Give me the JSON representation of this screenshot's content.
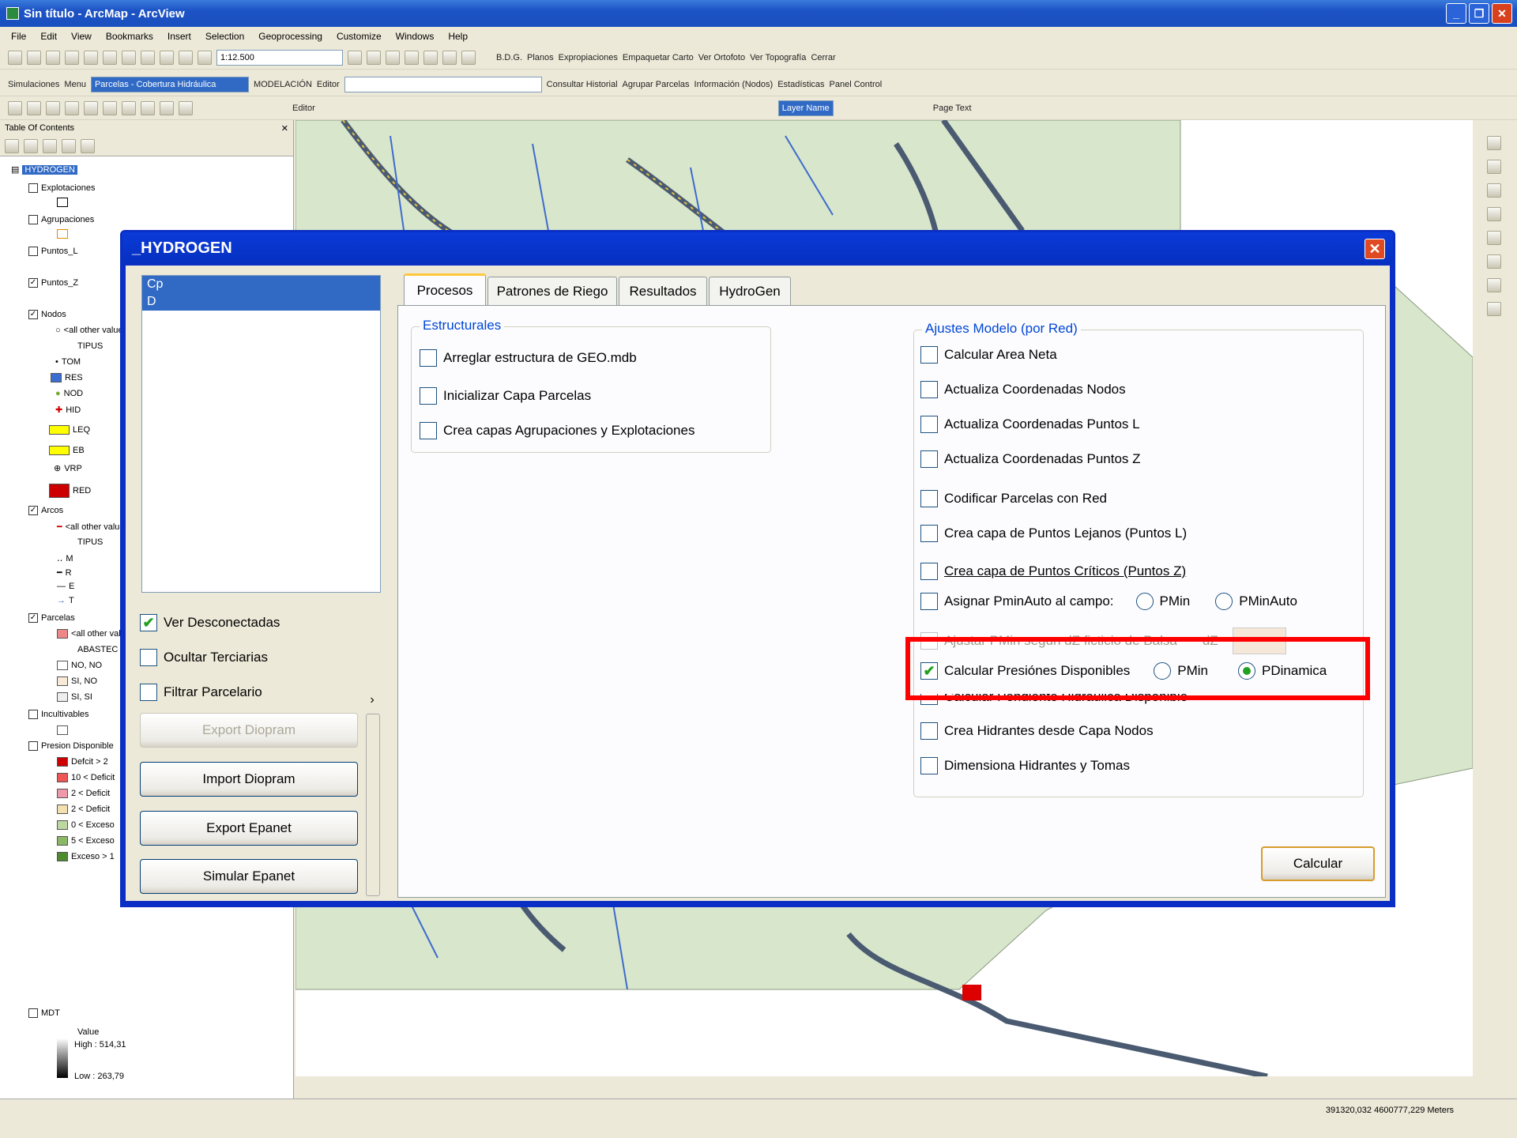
{
  "window": {
    "title": "Sin título - ArcMap - ArcView"
  },
  "menu": [
    "File",
    "Edit",
    "View",
    "Bookmarks",
    "Insert",
    "Selection",
    "Geoprocessing",
    "Customize",
    "Windows",
    "Help"
  ],
  "toolbar1": {
    "scale": "1:12.500",
    "buttons": [
      "B.D.G.",
      "Planos",
      "Expropiaciones",
      "Empaquetar Carto",
      "Ver Ortofoto",
      "Ver Topografía",
      "Cerrar"
    ]
  },
  "toolbar2": {
    "items": [
      "Simulaciones",
      "Menu"
    ],
    "layer_combo": "Parcelas - Cobertura Hidráulica",
    "model_combo": "MODELACIÓN",
    "editor": "Editor",
    "links": [
      "Consultar Historial",
      "Agrupar Parcelas",
      "Información (Nodos)",
      "Estadísticas",
      "Panel Control"
    ]
  },
  "toolbar3": {
    "editor": "Editor",
    "page_combo": "Page Text",
    "highlight": "Layer Name"
  },
  "toc": {
    "header": "Table Of Contents",
    "root": "HYDROGEN",
    "items": [
      {
        "label": "Explotaciones",
        "checked": false
      },
      {
        "label": "Agrupaciones",
        "checked": false
      },
      {
        "label": "Puntos_L",
        "checked": false
      },
      {
        "label": "Puntos_Z",
        "checked": true
      },
      {
        "label": "Nodos",
        "checked": true
      },
      {
        "label": "<all other values>"
      },
      {
        "label": "TIPUS"
      },
      {
        "label": "TOM"
      },
      {
        "label": "RES"
      },
      {
        "label": "NOD"
      },
      {
        "label": "HID"
      },
      {
        "label": "LEQ"
      },
      {
        "label": "EB"
      },
      {
        "label": "VRP"
      },
      {
        "label": "RED"
      },
      {
        "label": "Arcos",
        "checked": true
      },
      {
        "label": "<all other values>"
      },
      {
        "label": "TIPUS"
      },
      {
        "label": "M"
      },
      {
        "label": "R"
      },
      {
        "label": "E"
      },
      {
        "label": "T"
      },
      {
        "label": "Parcelas",
        "checked": true
      },
      {
        "label": "<all other values>"
      },
      {
        "label": "ABASTEC"
      },
      {
        "label": "NO, NO"
      },
      {
        "label": "SI, NO"
      },
      {
        "label": "SI, SI"
      },
      {
        "label": "Incultivables",
        "checked": false
      },
      {
        "label": "Presion Disponible",
        "checked": false
      },
      {
        "label": "Defcit > 2"
      },
      {
        "label": "10 < Deficit"
      },
      {
        "label": "2 < Deficit"
      },
      {
        "label": "2 < Deficit"
      },
      {
        "label": "0 < Exceso"
      },
      {
        "label": "5 < Exceso"
      },
      {
        "label": "Exceso > 1"
      },
      {
        "label": "MDT",
        "checked": false
      },
      {
        "label": "Value"
      },
      {
        "label": "High : 514,31"
      },
      {
        "label": "Low : 263,79"
      }
    ]
  },
  "status": {
    "coords": "391320,032  4600777,229 Meters"
  },
  "dialog": {
    "title": "_HYDROGEN",
    "list": [
      "Cp",
      "D"
    ],
    "left_checks": [
      {
        "label": "Ver Desconectadas",
        "checked": true
      },
      {
        "label": "Ocultar Terciarias",
        "checked": false
      },
      {
        "label": "Filtrar Parcelario",
        "checked": false
      }
    ],
    "buttons": {
      "export_diopram": "Export Diopram",
      "import_diopram": "Import Diopram",
      "export_epanet": "Export Epanet",
      "simular_epanet": "Simular Epanet",
      "calcular": "Calcular"
    },
    "tabs": [
      "Procesos",
      "Patrones de Riego",
      "Resultados",
      "HydroGen"
    ],
    "estructurales": {
      "title": "Estructurales",
      "items": [
        "Arreglar estructura de GEO.mdb",
        "Inicializar Capa Parcelas",
        "Crea capas Agrupaciones y Explotaciones"
      ]
    },
    "ajustes": {
      "title": "Ajustes Modelo (por Red)",
      "items": [
        "Calcular Area Neta",
        "Actualiza Coordenadas Nodos",
        "Actualiza Coordenadas Puntos L",
        "Actualiza Coordenadas Puntos Z",
        "Codificar Parcelas con Red",
        "Crea capa de Puntos Lejanos (Puntos L)",
        "Crea capa de Puntos Críticos (Puntos Z)",
        "Asignar PminAuto al campo:",
        "Ajustar PMin segun dZ ficticio de Balsa",
        "Calcular Presiónes Disponibles",
        "Calcular Pendiente Hidráulica Disponible",
        "Crea Hidrantes desde Capa Nodos",
        "Dimensiona Hidrantes y Tomas"
      ],
      "radio_pmin": "PMin",
      "radio_pminauto": "PMinAuto",
      "radio_pdinamica": "PDinamica",
      "dz_label": "dZ"
    }
  },
  "colors": {
    "xp_blue": "#0b2fc5",
    "highlight": "#ff0000",
    "check_green": "#21a121",
    "map_green": "#d8e6cc"
  }
}
